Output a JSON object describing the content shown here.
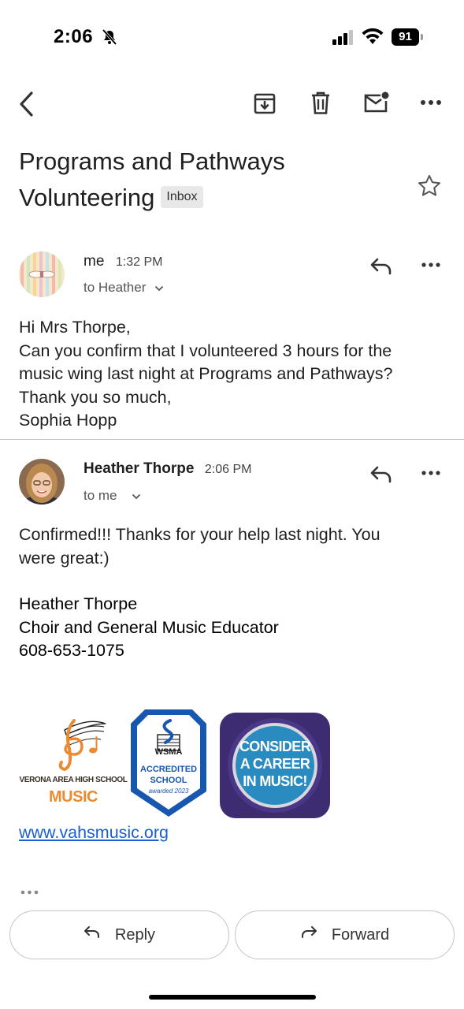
{
  "status_bar": {
    "time": "2:06",
    "battery": "91"
  },
  "toolbar": {
    "back_icon": "chevron-left-icon",
    "archive_icon": "archive-icon",
    "delete_icon": "trash-icon",
    "mark_unread_icon": "mail-unread-icon",
    "more_icon": "more-horizontal-icon"
  },
  "subject": {
    "title": "Programs and Pathways Volunteering",
    "label": "Inbox"
  },
  "messages": [
    {
      "sender": "me",
      "time": "1:32 PM",
      "recipient": "to Heather",
      "body": [
        "Hi Mrs Thorpe,",
        "Can you confirm that I volunteered 3 hours for the",
        "music wing last night at Programs and Pathways?",
        "Thank you so much,",
        "Sophia Hopp"
      ]
    },
    {
      "sender": "Heather Thorpe",
      "time": "2:06 PM",
      "recipient": "to me",
      "body": [
        "Confirmed!!! Thanks for your help last night. You",
        "were great:)"
      ],
      "signature": [
        "Heather Thorpe",
        "Choir and General Music Educator",
        "608-653-1075"
      ],
      "logos": {
        "verona": {
          "line1": "VERONA AREA HIGH SCHOOL",
          "line2": "MUSIC"
        },
        "wsma": {
          "name": "WSMA",
          "line1": "ACCREDITED",
          "line2": "SCHOOL",
          "line3": "awarded 2023"
        },
        "career": {
          "line1": "CONSIDER",
          "line2": "A CAREER",
          "line3": "IN MUSIC!"
        }
      },
      "link": "www.vahsmusic.org"
    }
  ],
  "actions": {
    "reply": "Reply",
    "forward": "Forward"
  }
}
